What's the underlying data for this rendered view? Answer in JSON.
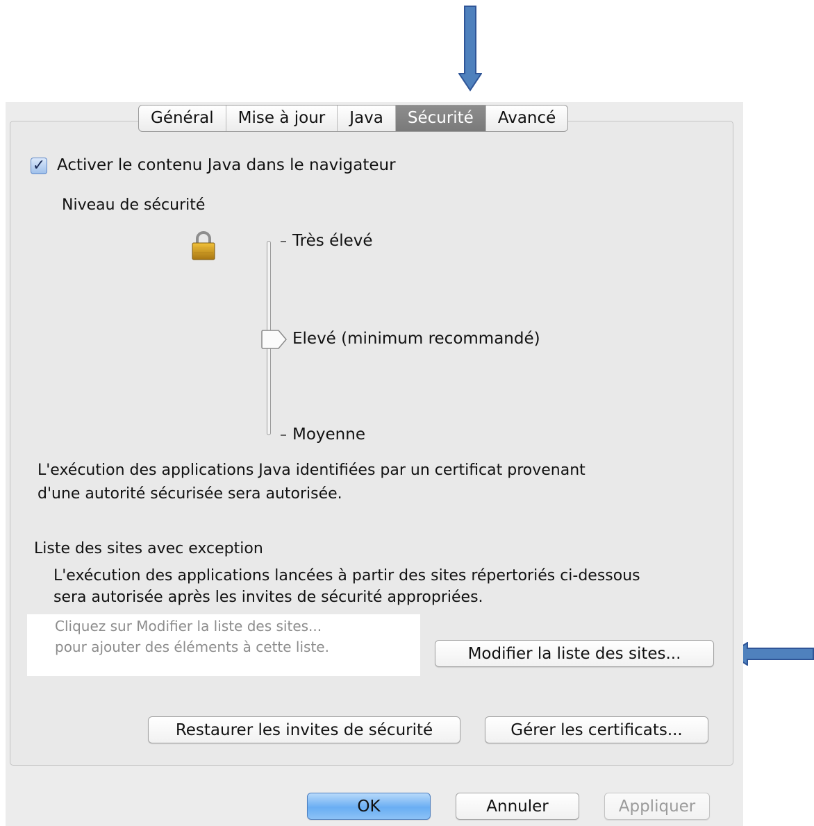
{
  "tabs": [
    {
      "label": "Général",
      "active": false
    },
    {
      "label": "Mise à jour",
      "active": false
    },
    {
      "label": "Java",
      "active": false
    },
    {
      "label": "Sécurité",
      "active": true
    },
    {
      "label": "Avancé",
      "active": false
    }
  ],
  "browser_content": {
    "checked": true,
    "label": "Activer le contenu Java dans le navigateur"
  },
  "security_level": {
    "title": "Niveau de sécurité",
    "levels": [
      "Très élevé",
      "Elevé (minimum recommandé)",
      "Moyenne"
    ],
    "selected": "Elevé (minimum recommandé)",
    "description_line1": "L'exécution des applications Java identifiées par un certificat provenant",
    "description_line2": "d'une autorité sécurisée sera autorisée."
  },
  "exception_sites": {
    "title": "Liste des sites avec exception",
    "description_line1": "L'exécution des applications lancées à partir des sites répertoriés ci-dessous",
    "description_line2": "sera autorisée après les invites de sécurité appropriées.",
    "placeholder_line1": "Cliquez sur Modifier la liste des sites...",
    "placeholder_line2": "pour ajouter des éléments à cette liste.",
    "edit_button": "Modifier la liste des sites..."
  },
  "actions": {
    "restore_prompts": "Restaurer les invites de sécurité",
    "manage_certificates": "Gérer les certificats..."
  },
  "footer": {
    "ok": "OK",
    "cancel": "Annuler",
    "apply": "Appliquer"
  },
  "colors": {
    "annotation_arrow": "#4f81bd",
    "primary_button": "#6aaef3",
    "active_tab": "#808080"
  }
}
